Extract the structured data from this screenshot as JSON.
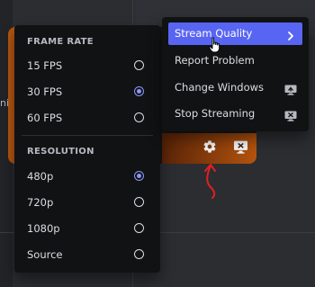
{
  "background": {
    "left_text_fragment": "ni",
    "colors": {
      "tile_orange": "#b8560f",
      "menu_bg": "#111214",
      "accent": "#5865f2"
    }
  },
  "settings_menu": {
    "frame_rate": {
      "heading": "FRAME RATE",
      "options": [
        {
          "label": "15 FPS",
          "selected": false
        },
        {
          "label": "30 FPS",
          "selected": true
        },
        {
          "label": "60 FPS",
          "selected": false
        }
      ]
    },
    "resolution": {
      "heading": "RESOLUTION",
      "options": [
        {
          "label": "480p",
          "selected": true
        },
        {
          "label": "720p",
          "selected": false
        },
        {
          "label": "1080p",
          "selected": false
        },
        {
          "label": "Source",
          "selected": false
        }
      ]
    }
  },
  "context_menu": {
    "items": [
      {
        "label": "Stream Quality",
        "icon": "chevron-right-icon",
        "active": true
      },
      {
        "label": "Report Problem",
        "icon": "",
        "active": false
      },
      {
        "label": "Change Windows",
        "icon": "screen-share-icon",
        "active": false
      },
      {
        "label": "Stop Streaming",
        "icon": "stop-stream-icon",
        "active": false
      }
    ]
  },
  "stream_tile": {
    "settings_icon": "gear-icon",
    "stop_icon": "stop-stream-icon",
    "annotation": "red-arrow-icon"
  }
}
